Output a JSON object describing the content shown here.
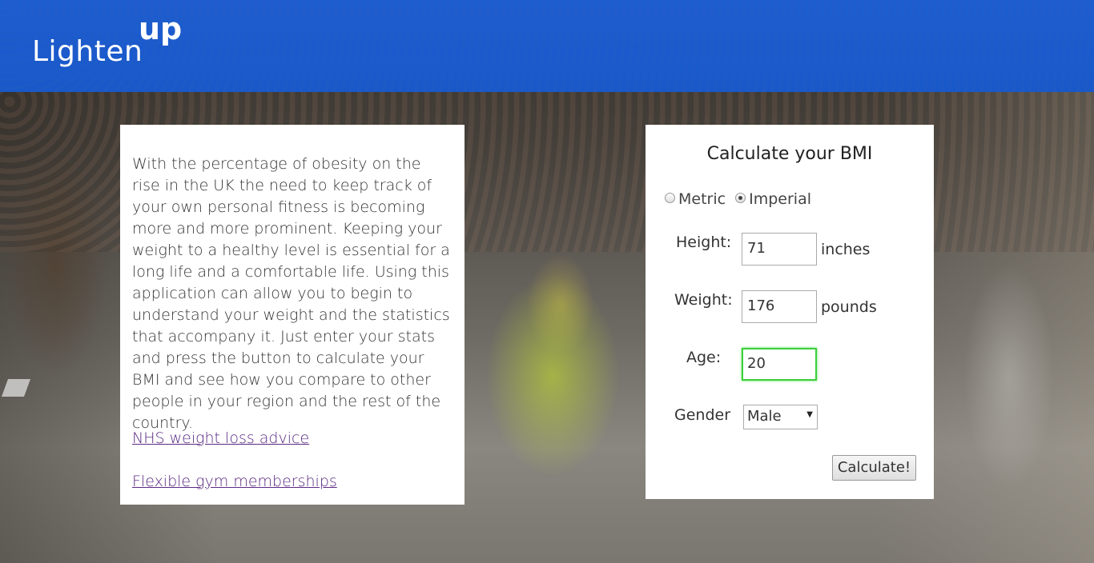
{
  "header": {
    "logo_main": "Lighten",
    "logo_sup": "up"
  },
  "info": {
    "paragraph": "With the percentage of obesity on the rise in the UK the need to keep track of your own personal fitness is becoming more and more prominent. Keeping your weight to a healthy level is essential for a long life and a comfortable life. Using this application can allow you to begin to understand your weight and the statistics that accompany it. Just enter your stats and press the button to calculate your BMI and see how you compare to other people in your region and the rest of the country.",
    "links": [
      {
        "label": "NHS weight loss advice"
      },
      {
        "label": "Flexible gym memberships"
      }
    ]
  },
  "calculator": {
    "title": "Calculate your BMI",
    "units": [
      {
        "label": "Metric",
        "checked": false
      },
      {
        "label": "Imperial",
        "checked": true
      }
    ],
    "height": {
      "label": "Height:",
      "value": "71",
      "unit": "inches"
    },
    "weight": {
      "label": "Weight:",
      "value": "176",
      "unit": "pounds"
    },
    "age": {
      "label": "Age:",
      "value": "20"
    },
    "gender": {
      "label": "Gender",
      "value": "Male"
    },
    "button_label": "Calculate!"
  },
  "colors": {
    "header_blue": "#1e5cc8",
    "link_purple": "#5a2a82",
    "focus_green": "#3ccf3c"
  }
}
